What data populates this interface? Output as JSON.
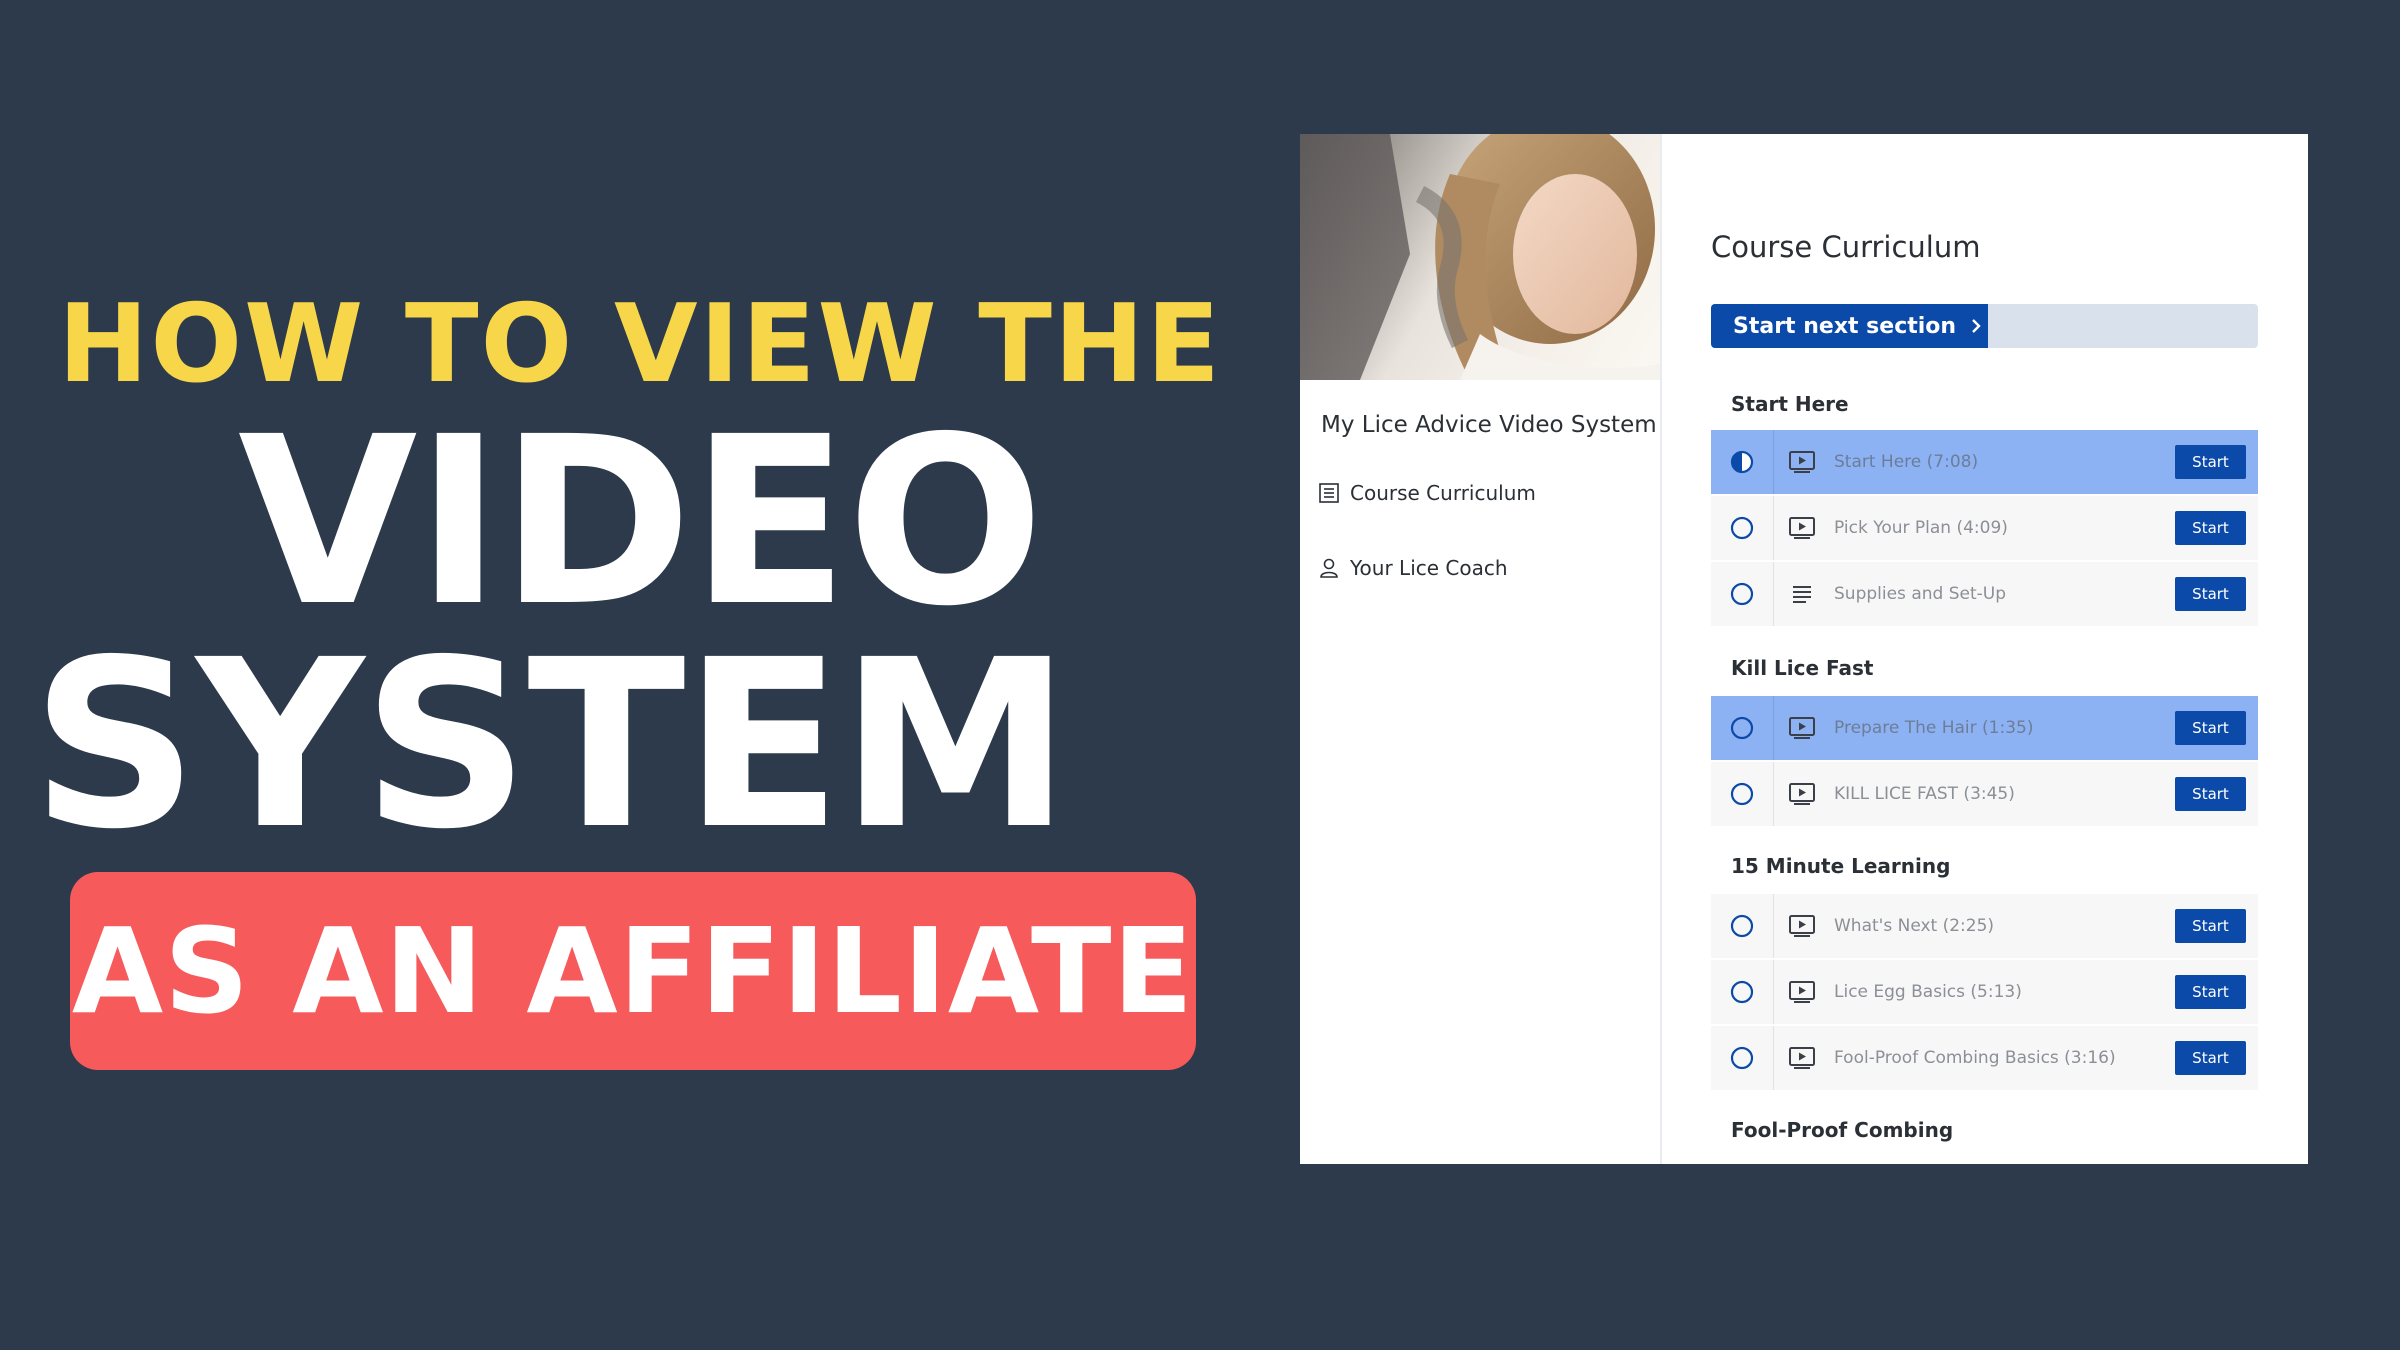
{
  "headline": {
    "line1": "HOW TO VIEW THE",
    "line2": "VIDEO",
    "line3": "SYSTEM",
    "pill": "AS AN AFFILIATE"
  },
  "sidebar": {
    "course_title": "My Lice Advice Video System",
    "items": [
      {
        "label": "Course Curriculum",
        "icon": "list-icon"
      },
      {
        "label": "Your Lice Coach",
        "icon": "user-icon"
      }
    ]
  },
  "curriculum": {
    "title": "Course Curriculum",
    "next_button": "Start next section",
    "progress_fraction": 0.506,
    "start_label": "Start",
    "sections": [
      {
        "name": "Start Here",
        "lessons": [
          {
            "title": "Start Here (7:08)",
            "type": "video",
            "status": "in-progress",
            "highlighted": true
          },
          {
            "title": "Pick Your Plan (4:09)",
            "type": "video",
            "status": "not-started",
            "highlighted": false
          },
          {
            "title": "Supplies and Set-Up",
            "type": "text",
            "status": "not-started",
            "highlighted": false
          }
        ]
      },
      {
        "name": "Kill Lice Fast",
        "lessons": [
          {
            "title": "Prepare The Hair (1:35)",
            "type": "video",
            "status": "not-started",
            "highlighted": true
          },
          {
            "title": "KILL LICE FAST (3:45)",
            "type": "video",
            "status": "not-started",
            "highlighted": false
          }
        ]
      },
      {
        "name": "15 Minute Learning",
        "lessons": [
          {
            "title": "What's Next (2:25)",
            "type": "video",
            "status": "not-started",
            "highlighted": false
          },
          {
            "title": "Lice Egg Basics (5:13)",
            "type": "video",
            "status": "not-started",
            "highlighted": false
          },
          {
            "title": "Fool-Proof Combing Basics (3:16)",
            "type": "video",
            "status": "not-started",
            "highlighted": false
          }
        ]
      },
      {
        "name": "Fool-Proof Combing",
        "lessons": []
      }
    ]
  },
  "colors": {
    "background": "#2c3a4b",
    "headline_yellow": "#f7d64a",
    "pill_red": "#f65a5b",
    "primary_blue": "#0b4aa8",
    "highlight_row": "#8cb2f3",
    "progress_track": "#d9e1ed"
  }
}
